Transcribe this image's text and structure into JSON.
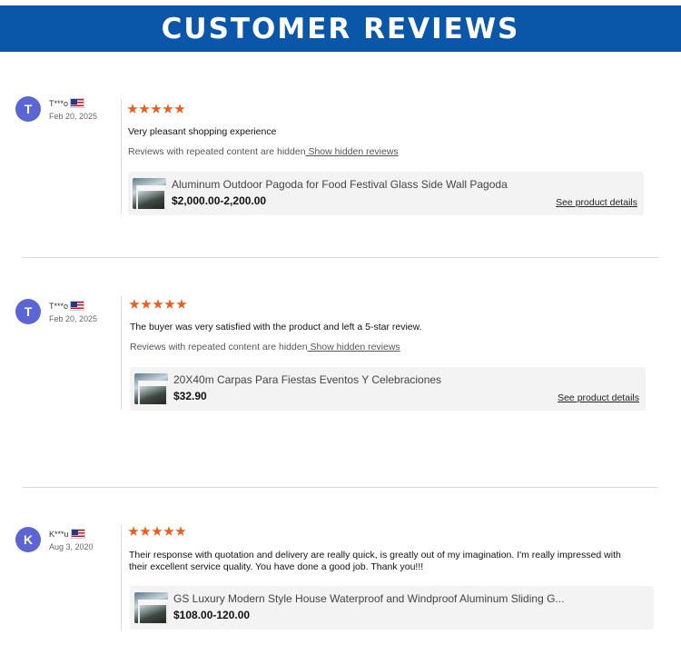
{
  "banner": {
    "title": "CUSTOMER REVIEWS"
  },
  "colors": {
    "banner_bg": "#0a56a8",
    "star": "#f05a1a",
    "avatar": "#5b65d3"
  },
  "reviews": [
    {
      "avatar_letter": "T",
      "user": "T***o",
      "country_flag": "us-flag-icon",
      "date": "Feb 20, 2025",
      "rating": 5,
      "text": "Very pleasant shopping experience",
      "hidden_note": "Reviews with repeated content are hidden",
      "hidden_link": " Show hidden reviews",
      "product": {
        "title": "Aluminum Outdoor Pagoda for Food Festival Glass Side Wall Pagoda",
        "price": "$2,000.00-2,200.00",
        "details_link": "See product details"
      }
    },
    {
      "avatar_letter": "T",
      "user": "T***o",
      "country_flag": "us-flag-icon",
      "date": "Feb 20, 2025",
      "rating": 5,
      "text": "The buyer was very satisfied with the product and left a 5-star review.",
      "hidden_note": "Reviews with repeated content are hidden",
      "hidden_link": " Show hidden reviews",
      "product": {
        "title": "20X40m Carpas Para Fiestas Eventos Y Celebraciones",
        "price": "$32.90",
        "details_link": "See product details"
      }
    },
    {
      "avatar_letter": "K",
      "user": "K***u",
      "country_flag": "us-flag-icon",
      "date": "Aug 3, 2020",
      "rating": 5,
      "text_line1": "Their response with quotation and delivery are really quick, is greatly out of my imagination. I'm really impressed with",
      "text_line2": "their excellent service quality. You have done a good job. Thank you!!!",
      "product": {
        "title": "GS Luxury Modern Style House Waterproof and Windproof Aluminum Sliding G...",
        "price": "$108.00-120.00"
      }
    }
  ]
}
